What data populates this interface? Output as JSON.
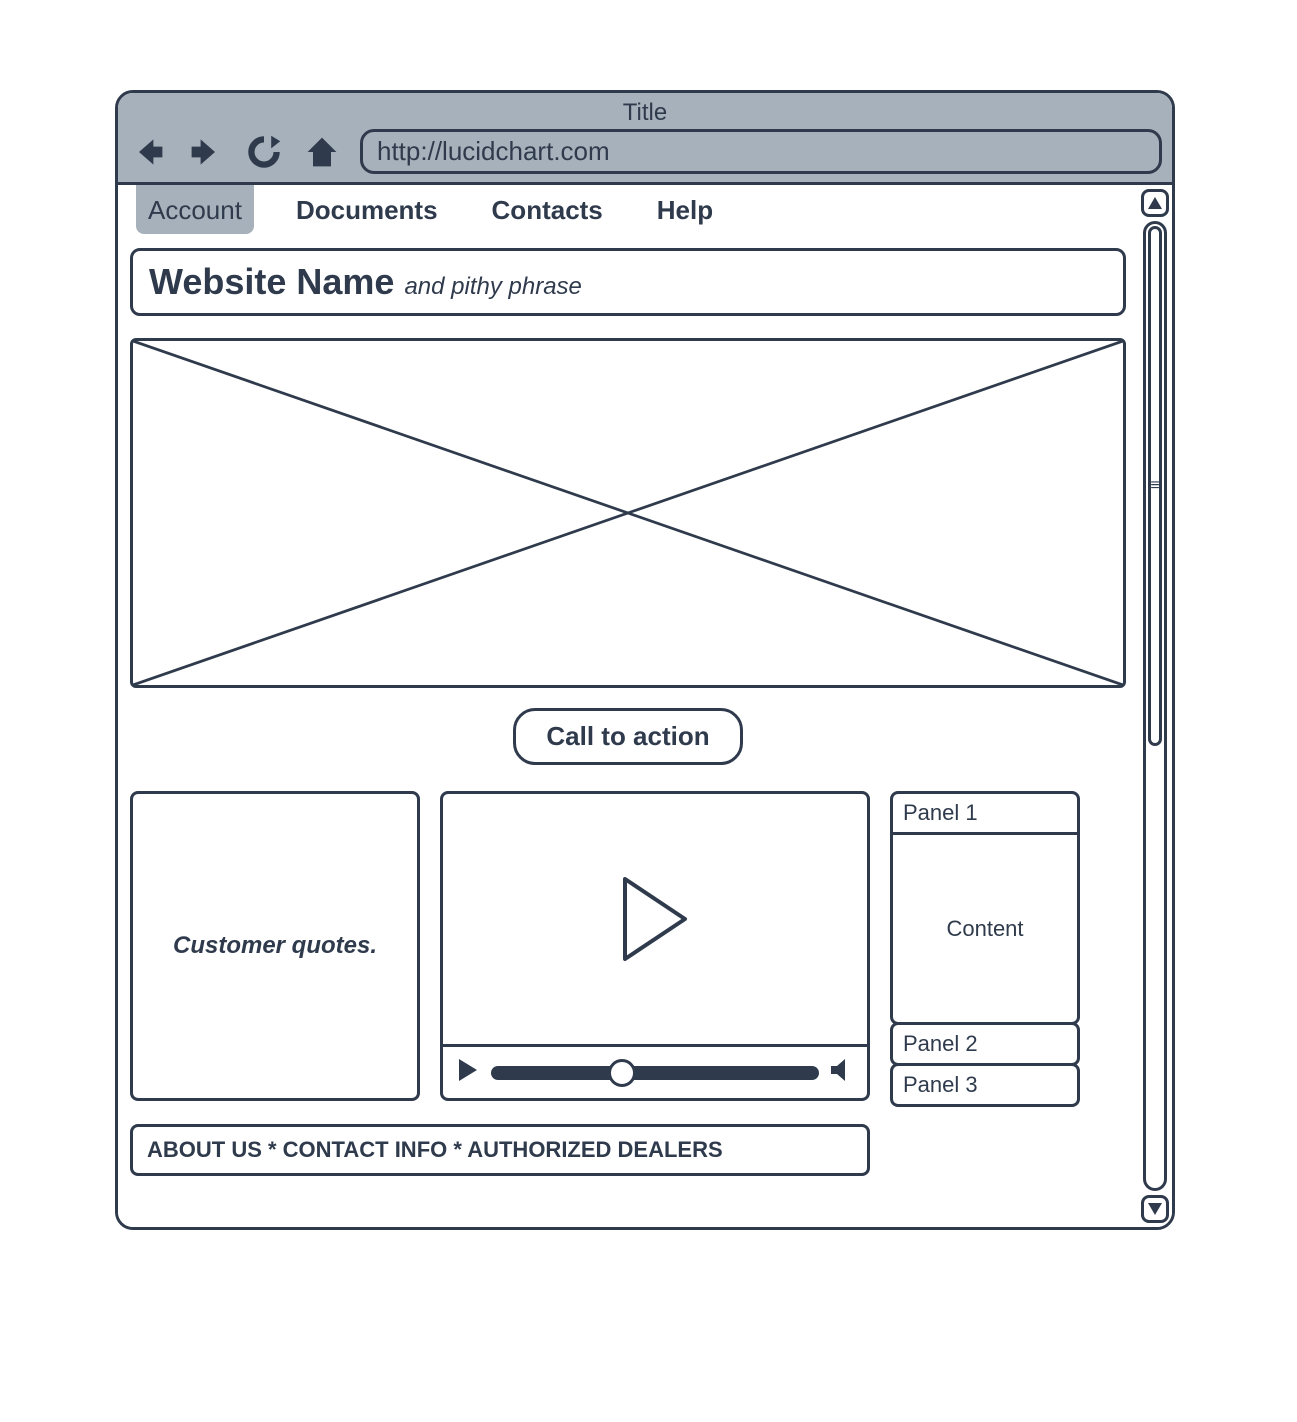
{
  "browser": {
    "window_title": "Title",
    "url": "http://lucidchart.com"
  },
  "tabs": [
    {
      "label": "Account",
      "active": true
    },
    {
      "label": "Documents",
      "active": false
    },
    {
      "label": "Contacts",
      "active": false
    },
    {
      "label": "Help",
      "active": false
    }
  ],
  "header": {
    "site_name": "Website Name",
    "tagline": "and pithy phrase"
  },
  "cta": {
    "label": "Call to action"
  },
  "quotes": {
    "text": "Customer quotes."
  },
  "accordion": {
    "panels": [
      {
        "label": "Panel 1",
        "expanded": true,
        "content": "Content"
      },
      {
        "label": "Panel 2",
        "expanded": false
      },
      {
        "label": "Panel 3",
        "expanded": false
      }
    ]
  },
  "footer": {
    "text": "ABOUT US  * CONTACT INFO * AUTHORIZED DEALERS"
  },
  "scrollbar": {
    "thumb_glyph": "≡"
  },
  "colors": {
    "stroke": "#2f3b4c",
    "chrome": "#a7b1bb"
  }
}
